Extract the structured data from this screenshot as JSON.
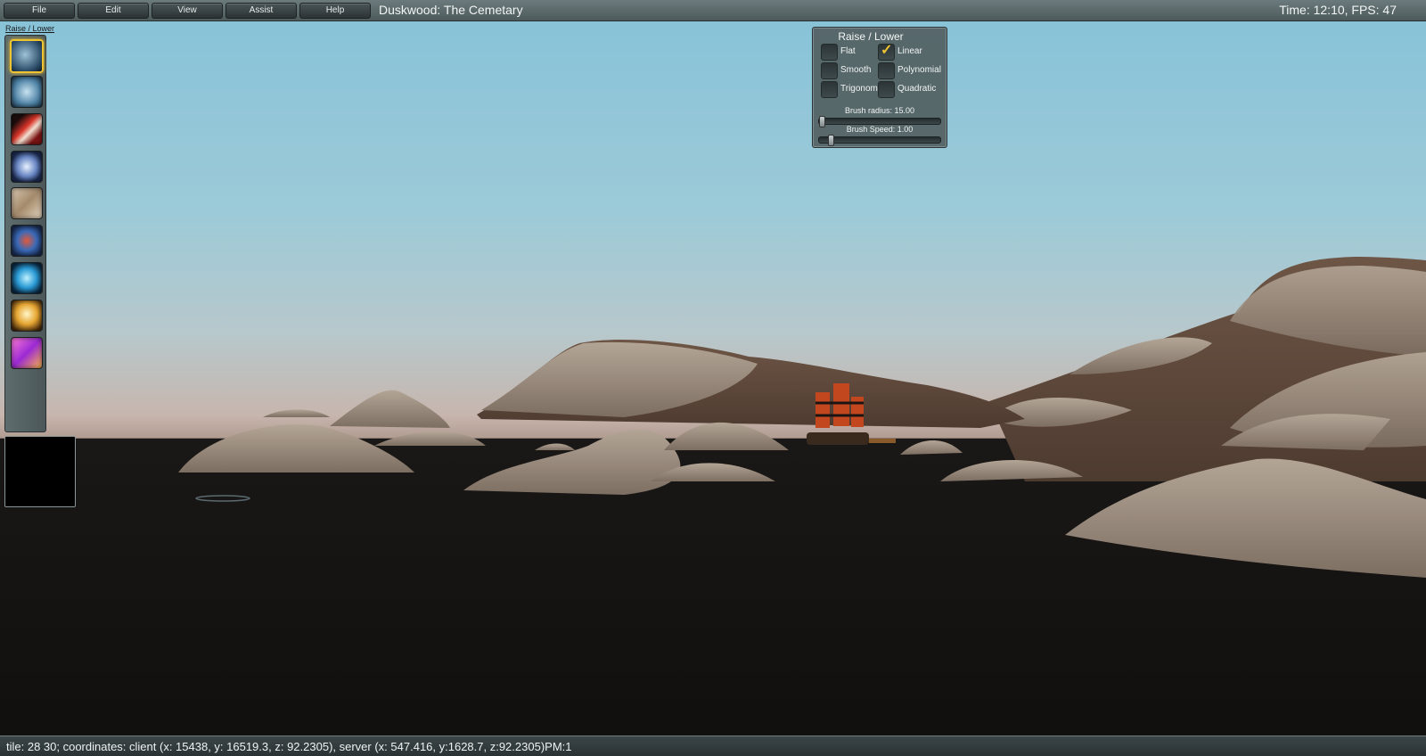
{
  "menu": {
    "items": [
      "File",
      "Edit",
      "View",
      "Assist",
      "Help"
    ],
    "title": "Duskwood: The Cemetary",
    "time_fps": "Time: 12:10, FPS: 47"
  },
  "palette": {
    "title": "Raise / Lower",
    "tools": [
      {
        "icon": "raise-lower-icon",
        "selected": true
      },
      {
        "icon": "flatten-icon"
      },
      {
        "icon": "paint-brush-icon"
      },
      {
        "icon": "holes-icon"
      },
      {
        "icon": "texture-map-icon"
      },
      {
        "icon": "area-id-icon"
      },
      {
        "icon": "water-icon"
      },
      {
        "icon": "light-icon"
      },
      {
        "icon": "impassable-icon"
      }
    ]
  },
  "raise_lower": {
    "title": "Raise / Lower",
    "options": [
      {
        "label": "Flat",
        "checked": false
      },
      {
        "label": "Linear",
        "checked": true
      },
      {
        "label": "Smooth",
        "checked": false
      },
      {
        "label": "Polynomial",
        "checked": false
      },
      {
        "label": "Trigonom",
        "checked": false
      },
      {
        "label": "Quadratic",
        "checked": false
      }
    ],
    "brush_radius_label": "Brush radius: 15.00",
    "brush_speed_label": "Brush Speed: 1.00",
    "colors": {
      "accent": "#f0c330"
    }
  },
  "status": {
    "text": "tile: 28 30; coordinates: client (x: 15438, y: 16519.3, z: 92.2305), server (x: 547.416, y:1628.7, z:92.2305)PM:1"
  }
}
